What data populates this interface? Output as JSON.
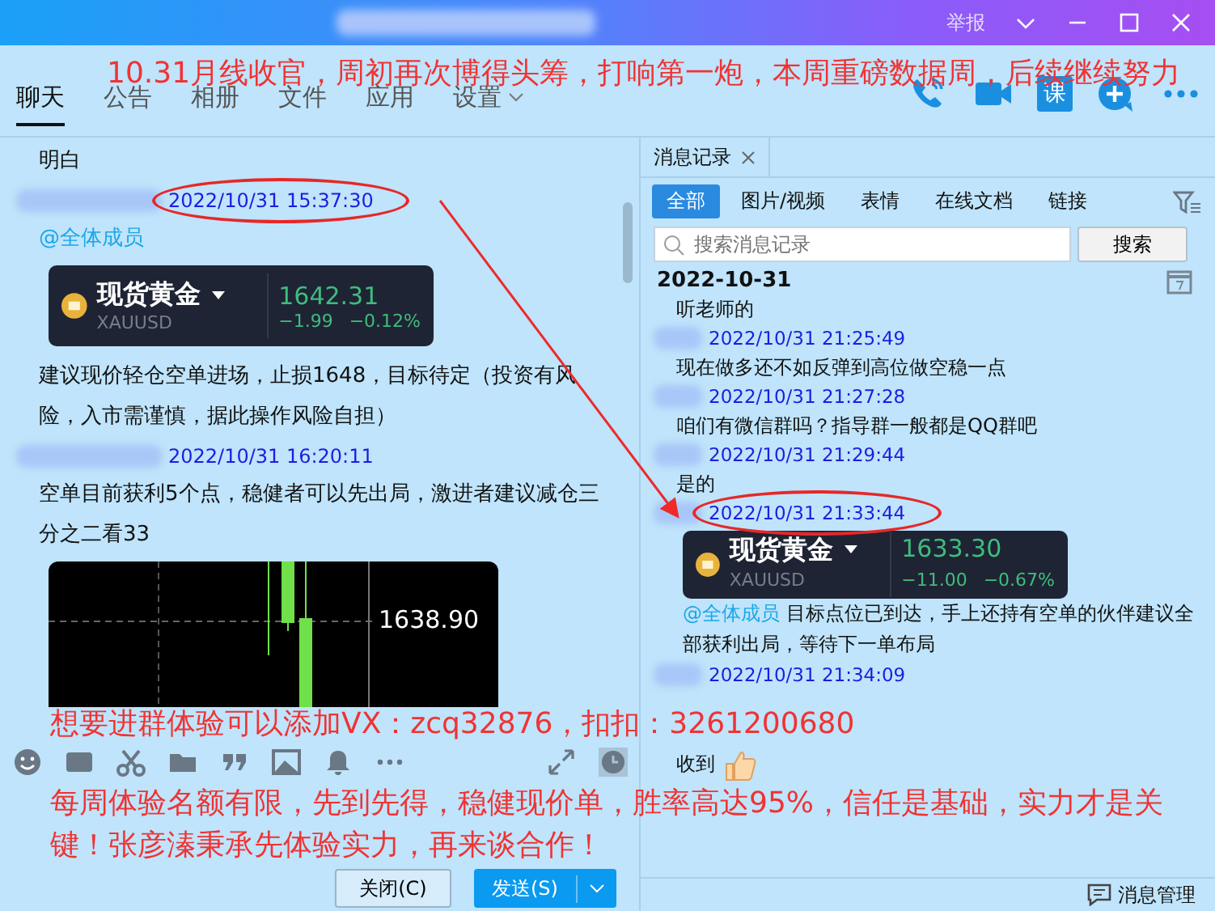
{
  "title_bar": {
    "report": "举报"
  },
  "tabs": [
    {
      "label": "聊天",
      "selected": true,
      "has_menu": false
    },
    {
      "label": "公告",
      "selected": false,
      "has_menu": false
    },
    {
      "label": "相册",
      "selected": false,
      "has_menu": false
    },
    {
      "label": "文件",
      "selected": false,
      "has_menu": false
    },
    {
      "label": "应用",
      "selected": false,
      "has_menu": false
    },
    {
      "label": "设置",
      "selected": false,
      "has_menu": true
    }
  ],
  "course_button": "课",
  "chat": {
    "messages": [
      {
        "kind": "text",
        "text": "明白"
      },
      {
        "kind": "header",
        "time": "2022/10/31 15:37:30",
        "circled": true
      },
      {
        "kind": "mention",
        "text": "@全体成员"
      },
      {
        "kind": "quote",
        "name": "现货黄金",
        "symbol": "XAUUSD",
        "price": "1642.31",
        "change": "−1.99",
        "percent": "−0.12%"
      },
      {
        "kind": "text",
        "text": "建议现价轻仓空单进场，止损1648，目标待定（投资有风险，入市需谨慎，据此操作风险自担）"
      },
      {
        "kind": "header",
        "time": "2022/10/31 16:20:11",
        "circled": false
      },
      {
        "kind": "text",
        "text": "空单目前获利5个点，稳健者可以先出局，激进者建议减仓三分之二看33"
      },
      {
        "kind": "chart",
        "price_label": "1638.90"
      }
    ]
  },
  "input": {
    "close_button": "关闭(C)",
    "send_button": "发送(S)"
  },
  "history": {
    "tab": "消息记录",
    "filters": [
      {
        "label": "全部",
        "selected": true
      },
      {
        "label": "图片/视频",
        "selected": false
      },
      {
        "label": "表情",
        "selected": false
      },
      {
        "label": "在线文档",
        "selected": false
      },
      {
        "label": "链接",
        "selected": false
      }
    ],
    "search": {
      "placeholder": "搜索消息记录",
      "button": "搜索"
    },
    "date": "2022-10-31",
    "messages": [
      {
        "kind": "text",
        "text": "听老师的"
      },
      {
        "kind": "header",
        "time": "2022/10/31 21:25:49",
        "circled": false
      },
      {
        "kind": "text",
        "text": "现在做多还不如反弹到高位做空稳一点"
      },
      {
        "kind": "header",
        "time": "2022/10/31 21:27:28",
        "circled": false
      },
      {
        "kind": "text",
        "text": "咱们有微信群吗？指导群一般都是QQ群吧"
      },
      {
        "kind": "header",
        "time": "2022/10/31 21:29:44",
        "circled": false
      },
      {
        "kind": "text",
        "text": "是的"
      },
      {
        "kind": "header",
        "time": "2022/10/31 21:33:44",
        "circled": true
      },
      {
        "kind": "quote_mention",
        "name": "现货黄金",
        "symbol": "XAUUSD",
        "price": "1633.30",
        "change": "−11.00",
        "percent": "−0.67%",
        "mention": "@全体成员",
        "text": " 目标点位已到达，手上还持有空单的伙伴建议全部获利出局，等待下一单布局"
      },
      {
        "kind": "header",
        "time": "2022/10/31 21:34:09",
        "circled": false
      },
      {
        "kind": "thumbs",
        "text": "收到"
      }
    ],
    "footer": "消息管理"
  },
  "annotations": [
    {
      "text": "10.31月线收官，周初再次博得头筹，打响第一炮，本周重磅数据周，后续继续努力"
    },
    {
      "text": "想要进群体验可以添加VX：zcq32876，扣扣：3261200680"
    },
    {
      "text": "每周体验名额有限，先到先得，稳健现价单，胜率高达95%，信任是基础，实力才是关键！张彦溱秉承先体验实力，再来谈合作！"
    }
  ]
}
